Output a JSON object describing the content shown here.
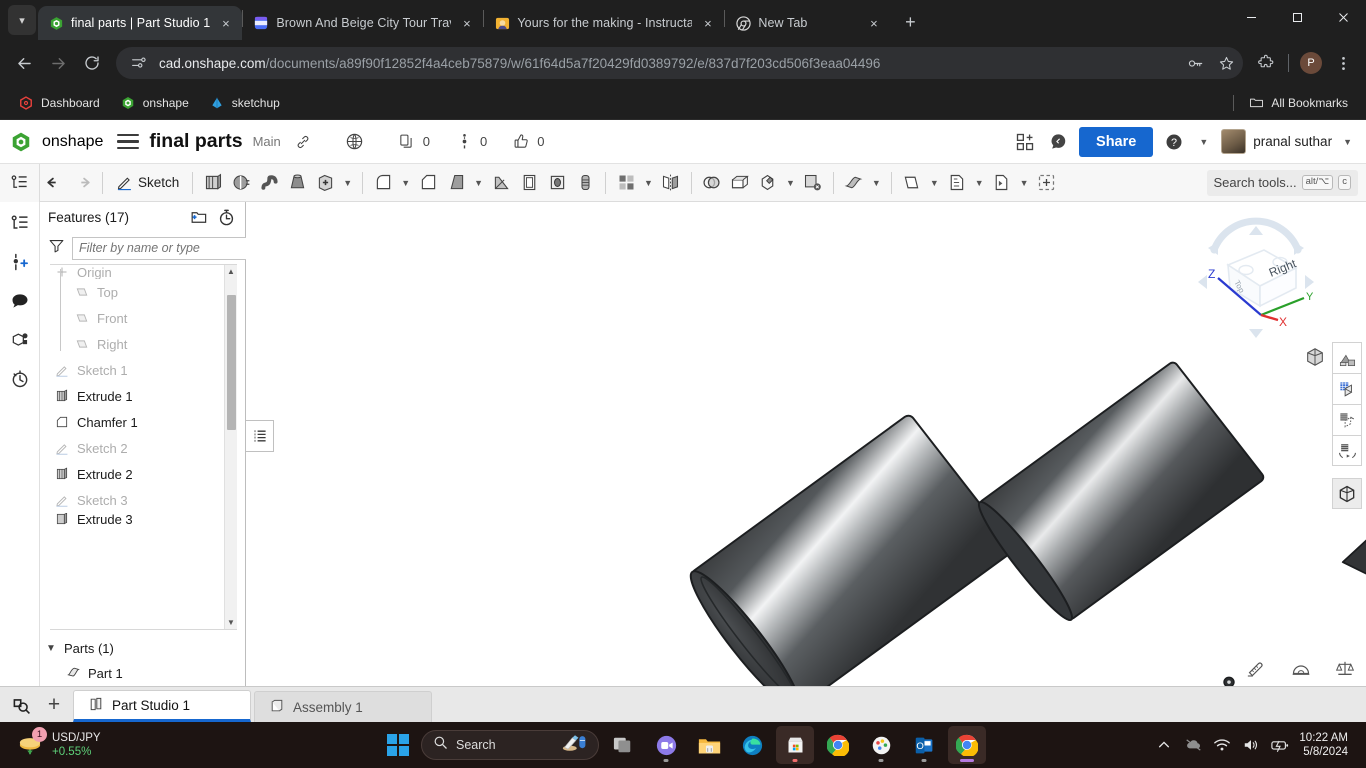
{
  "browser": {
    "tabs": [
      {
        "title": "final parts | Part Studio 1",
        "favicon": "onshape-icon",
        "active": true
      },
      {
        "title": "Brown And Beige City Tour Trav",
        "favicon": "slides-icon",
        "active": false
      },
      {
        "title": "Yours for the making - Instructa",
        "favicon": "instructables-icon",
        "active": false
      },
      {
        "title": "New Tab",
        "favicon": "chrome-icon",
        "active": false
      }
    ],
    "close_label": "×",
    "new_tab_label": "+",
    "window_controls": {
      "minimize": "–",
      "maximize": "❐",
      "close": "✕"
    },
    "omnibox": {
      "url_host": "cad.onshape.com",
      "url_path": "/documents/a89f90f12852f4a4ceb75879/w/61f64d5a7f20429fd0389792/e/837d7f203cd506f3eaa04496",
      "site_icon": "tune-icon",
      "actions": [
        "key-icon",
        "star-icon",
        "extensions-icon",
        "profile-avatar",
        "kebab-menu-icon"
      ],
      "profile_initial": "P"
    },
    "bookmarks": [
      {
        "label": "Dashboard",
        "icon": "onshape-red-icon"
      },
      {
        "label": "onshape",
        "icon": "onshape-green-icon"
      },
      {
        "label": "sketchup",
        "icon": "sketchup-icon"
      }
    ],
    "all_bookmarks_label": "All Bookmarks"
  },
  "onshape": {
    "brand": "onshape",
    "document_title": "final parts",
    "workspace": "Main",
    "counts": {
      "comments": "0",
      "versions": "0",
      "likes": "0"
    },
    "share_label": "Share",
    "user_name": "pranal suthar",
    "toolbar": {
      "sketch_label": "Sketch",
      "search_placeholder": "Search tools...",
      "search_kbd_1": "alt/⌥",
      "search_kbd_2": "c",
      "tools": [
        "feature-tree-icon",
        "undo-icon",
        "redo-icon",
        "sketch-icon",
        "extrude-icon",
        "revolve-icon",
        "sweep-icon",
        "loft-icon",
        "thicken-icon",
        "fillet-icon",
        "chamfer-icon",
        "draft-icon",
        "rib-icon",
        "shell-icon",
        "hole-icon",
        "thread-icon",
        "linear-pattern-icon",
        "mirror-icon",
        "boolean-icon",
        "split-icon",
        "transform-icon",
        "delete-face-icon",
        "sheet-metal-icon",
        "plane-icon",
        "variable-icon",
        "derive-icon",
        "composite-part-icon"
      ]
    },
    "features_panel": {
      "title": "Features (17)",
      "add-folder-icon": "add-folder-icon",
      "rollback-icon": "rollback-icon",
      "filter_placeholder": "Filter by name or type",
      "tree": [
        {
          "label": "Origin",
          "icon": "origin-icon",
          "dim": true,
          "indent": false,
          "clipped": true
        },
        {
          "label": "Top",
          "icon": "plane-icon",
          "dim": true,
          "indent": true
        },
        {
          "label": "Front",
          "icon": "plane-icon",
          "dim": true,
          "indent": true
        },
        {
          "label": "Right",
          "icon": "plane-icon",
          "dim": true,
          "indent": true
        },
        {
          "label": "Sketch 1",
          "icon": "sketch-icon",
          "dim": true,
          "indent": false
        },
        {
          "label": "Extrude 1",
          "icon": "extrude-icon",
          "dim": false,
          "indent": false
        },
        {
          "label": "Chamfer 1",
          "icon": "chamfer-icon",
          "dim": false,
          "indent": false
        },
        {
          "label": "Sketch 2",
          "icon": "sketch-icon",
          "dim": true,
          "indent": false
        },
        {
          "label": "Extrude 2",
          "icon": "extrude-icon",
          "dim": false,
          "indent": false
        },
        {
          "label": "Sketch 3",
          "icon": "sketch-icon",
          "dim": true,
          "indent": false
        },
        {
          "label": "Extrude 3",
          "icon": "extrude-icon",
          "dim": false,
          "indent": false
        }
      ],
      "parts_header": "Parts (1)",
      "parts": [
        {
          "label": "Part 1",
          "icon": "part-icon"
        }
      ]
    },
    "viewcube": {
      "face_label": "Right",
      "axis_x": "X",
      "axis_y": "Y",
      "axis_z": "Z",
      "axis_x_color": "#e03030",
      "axis_y_color": "#2aa02a",
      "axis_z_color": "#2a3ad0"
    },
    "view_tools": [
      "view-orientation-icon",
      "render-icon",
      "section-view-icon",
      "explode-icon",
      "zoom-fit-icon",
      "display-mode-icon"
    ],
    "measure_tools": [
      "measure-icon",
      "protractor-icon",
      "mass-properties-icon"
    ],
    "doc_tabs": {
      "search_icon": "tab-search-icon",
      "plus_label": "+",
      "items": [
        {
          "label": "Part Studio 1",
          "icon": "part-studio-icon",
          "active": true
        },
        {
          "label": "Assembly 1",
          "icon": "assembly-icon",
          "active": false
        }
      ]
    }
  },
  "taskbar": {
    "widget": {
      "badge": "1",
      "title": "USD/JPY",
      "change": "+0.55%"
    },
    "search_placeholder": "Search",
    "apps": [
      {
        "name": "widgets-icon",
        "open": false
      },
      {
        "name": "task-view-icon",
        "open": false
      },
      {
        "name": "zoom-icon",
        "open": false
      },
      {
        "name": "file-explorer-icon",
        "open": false
      },
      {
        "name": "edge-icon",
        "open": false
      },
      {
        "name": "microsoft-store-icon",
        "open": true
      },
      {
        "name": "chrome-icon",
        "open": false
      },
      {
        "name": "paint-icon",
        "open": false
      },
      {
        "name": "outlook-icon",
        "open": false
      },
      {
        "name": "chrome-active-icon",
        "open": true
      }
    ],
    "tray": [
      "show-hidden-icons",
      "onedrive-icon",
      "wifi-icon",
      "volume-icon",
      "battery-icon"
    ],
    "time": "10:22 AM",
    "date": "5/8/2024"
  }
}
